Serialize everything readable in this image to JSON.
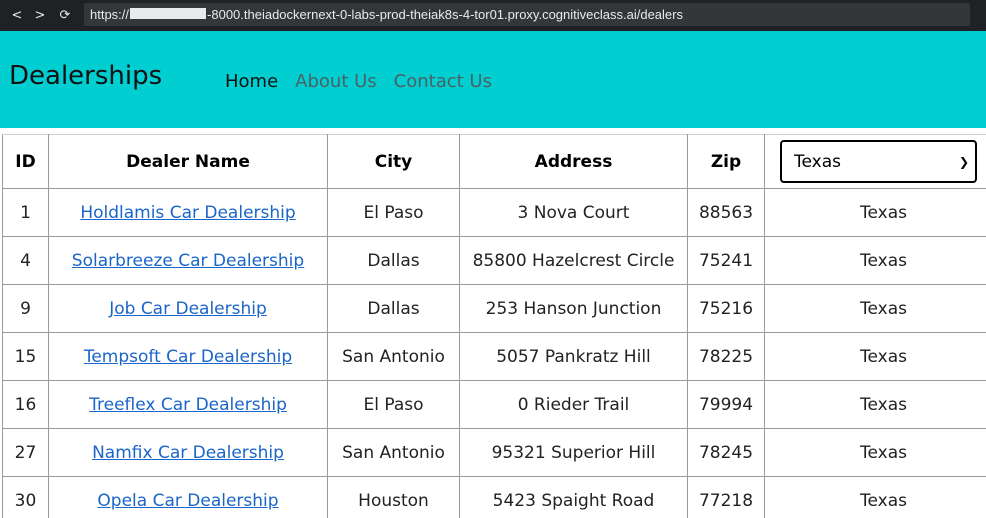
{
  "browser": {
    "back_icon": "<",
    "forward_icon": ">",
    "reload_icon": "⟳",
    "url_prefix": "https://",
    "url_suffix": "-8000.theiadockernext-0-labs-prod-theiak8s-4-tor01.proxy.cognitiveclass.ai/dealers"
  },
  "navbar": {
    "brand": "Dealerships",
    "links": [
      {
        "label": "Home",
        "active": true
      },
      {
        "label": "About Us",
        "active": false
      },
      {
        "label": "Contact Us",
        "active": false
      }
    ],
    "background": "#00ced1"
  },
  "table": {
    "headers": {
      "id": "ID",
      "name": "Dealer Name",
      "city": "City",
      "address": "Address",
      "zip": "Zip"
    },
    "state_filter": {
      "selected": "Texas"
    },
    "link_color": "#1a65c9",
    "rows": [
      {
        "id": "1",
        "name": "Holdlamis Car Dealership",
        "city": "El Paso",
        "address": "3 Nova Court",
        "zip": "88563",
        "state": "Texas"
      },
      {
        "id": "4",
        "name": "Solarbreeze Car Dealership",
        "city": "Dallas",
        "address": "85800 Hazelcrest Circle",
        "zip": "75241",
        "state": "Texas"
      },
      {
        "id": "9",
        "name": "Job Car Dealership",
        "city": "Dallas",
        "address": "253 Hanson Junction",
        "zip": "75216",
        "state": "Texas"
      },
      {
        "id": "15",
        "name": "Tempsoft Car Dealership",
        "city": "San Antonio",
        "address": "5057 Pankratz Hill",
        "zip": "78225",
        "state": "Texas"
      },
      {
        "id": "16",
        "name": "Treeflex Car Dealership",
        "city": "El Paso",
        "address": "0 Rieder Trail",
        "zip": "79994",
        "state": "Texas"
      },
      {
        "id": "27",
        "name": "Namfix Car Dealership",
        "city": "San Antonio",
        "address": "95321 Superior Hill",
        "zip": "78245",
        "state": "Texas"
      },
      {
        "id": "30",
        "name": "Opela Car Dealership",
        "city": "Houston",
        "address": "5423 Spaight Road",
        "zip": "77218",
        "state": "Texas"
      }
    ]
  }
}
